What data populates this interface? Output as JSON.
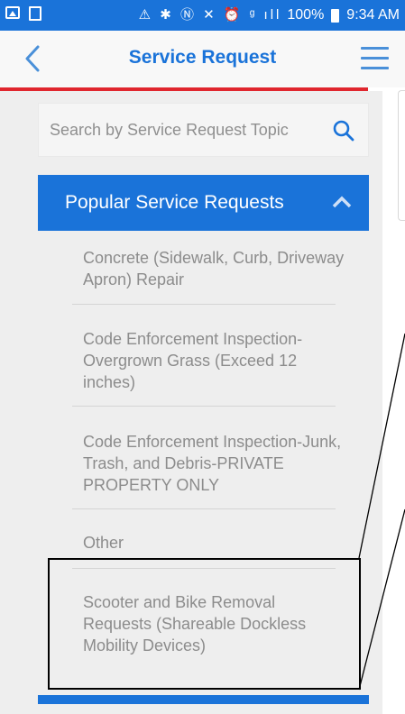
{
  "status_bar": {
    "icons": "⚠ ✱ Ⓝ ✕ ⏰ ᵍ ıll",
    "battery": "100%",
    "time": "9:34 AM"
  },
  "header": {
    "title": "Service Request"
  },
  "search": {
    "placeholder": "Search by Service Request Topic"
  },
  "accordion": {
    "title": "Popular Service Requests",
    "items": [
      {
        "label": "Concrete (Sidewalk, Curb, Driveway Apron) Repair"
      },
      {
        "label": "Code Enforcement Inspection-Overgrown Grass (Exceed 12 inches)"
      },
      {
        "label": "Code Enforcement Inspection-Junk, Trash, and Debris-PRIVATE PROPERTY ONLY"
      },
      {
        "label": "Other"
      },
      {
        "label": "Scooter and Bike Removal Requests (Shareable Dockless Mobility Devices)"
      }
    ]
  },
  "colors": {
    "brand_blue": "#1a73d9",
    "accent_red": "#e0262e",
    "muted_text": "#8c8c8c"
  }
}
